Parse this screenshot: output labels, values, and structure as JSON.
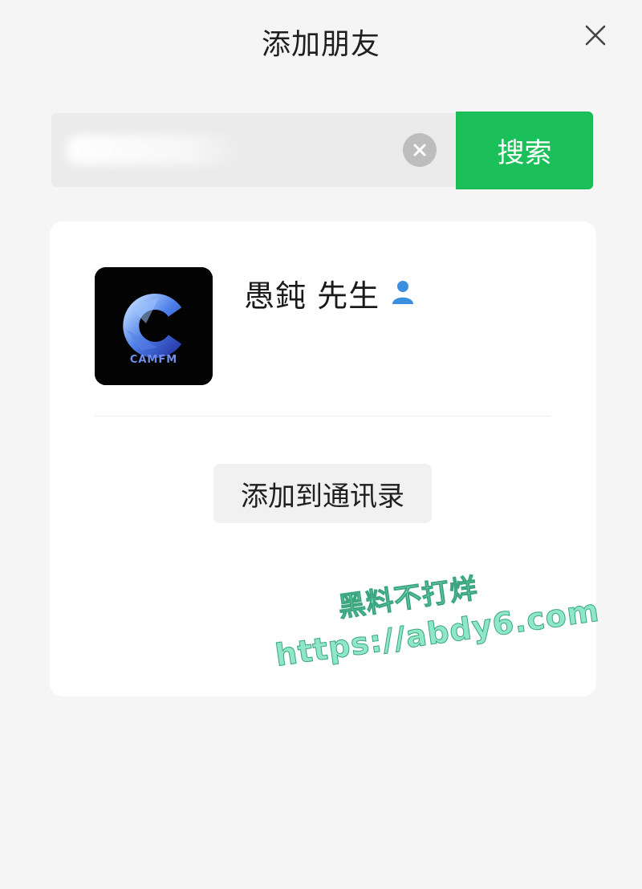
{
  "header": {
    "title": "添加朋友",
    "close_icon": "close-icon"
  },
  "search": {
    "value": "",
    "placeholder": "",
    "clear_icon": "clear-circle-icon",
    "button_label": "搜索"
  },
  "result": {
    "avatar": {
      "logo_text": "CAMFM",
      "logo_letter": "C"
    },
    "name": "愚鈍 先生",
    "contact_type_icon": "user-icon",
    "add_button_label": "添加到通讯录"
  },
  "watermark": {
    "line1": "黑料不打烊",
    "line2": "https://abdy6.com"
  },
  "colors": {
    "accent": "#1bc05a",
    "background": "#f5f5f5",
    "card": "#ffffff",
    "input_bg": "#ebebeb",
    "user_icon": "#3b8fe0"
  }
}
